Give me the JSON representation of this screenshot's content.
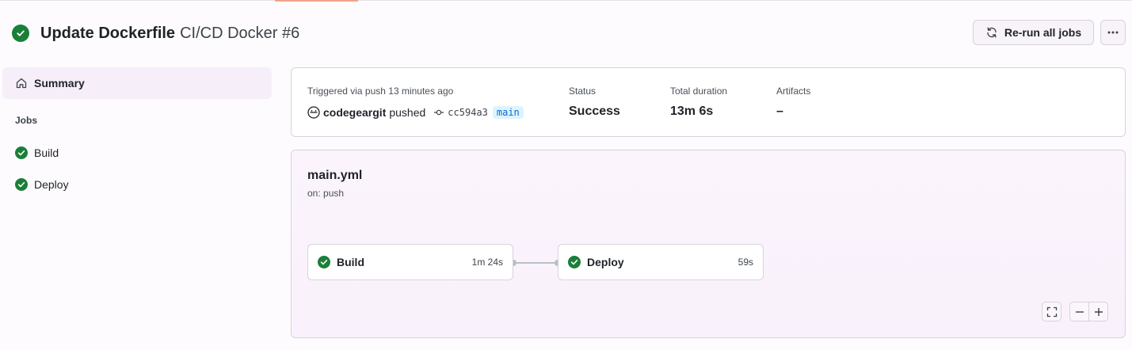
{
  "header": {
    "title": "Update Dockerfile",
    "subtitle": "CI/CD Docker #6",
    "rerun_label": "Re-run all jobs"
  },
  "sidebar": {
    "summary_label": "Summary",
    "jobs_heading": "Jobs",
    "jobs": [
      {
        "label": "Build",
        "status": "success"
      },
      {
        "label": "Deploy",
        "status": "success"
      }
    ]
  },
  "summary": {
    "trigger_text": "Triggered via push 13 minutes ago",
    "user": "codegeargit",
    "action": "pushed",
    "commit": "cc594a3",
    "branch": "main",
    "status_label": "Status",
    "status_value": "Success",
    "duration_label": "Total duration",
    "duration_value": "13m 6s",
    "artifacts_label": "Artifacts",
    "artifacts_value": "–"
  },
  "workflow": {
    "file": "main.yml",
    "trigger": "on: push",
    "jobs": [
      {
        "name": "Build",
        "duration": "1m 24s"
      },
      {
        "name": "Deploy",
        "duration": "59s"
      }
    ]
  },
  "colors": {
    "success": "#1a7f37",
    "branch_bg": "#ddf4ff",
    "branch_fg": "#0969da"
  },
  "icons": [
    "check-circle-icon",
    "sync-icon",
    "kebab-horizontal-icon",
    "home-icon",
    "commit-icon",
    "avatar-icon",
    "fullscreen-icon",
    "zoom-out-icon",
    "zoom-in-icon"
  ]
}
